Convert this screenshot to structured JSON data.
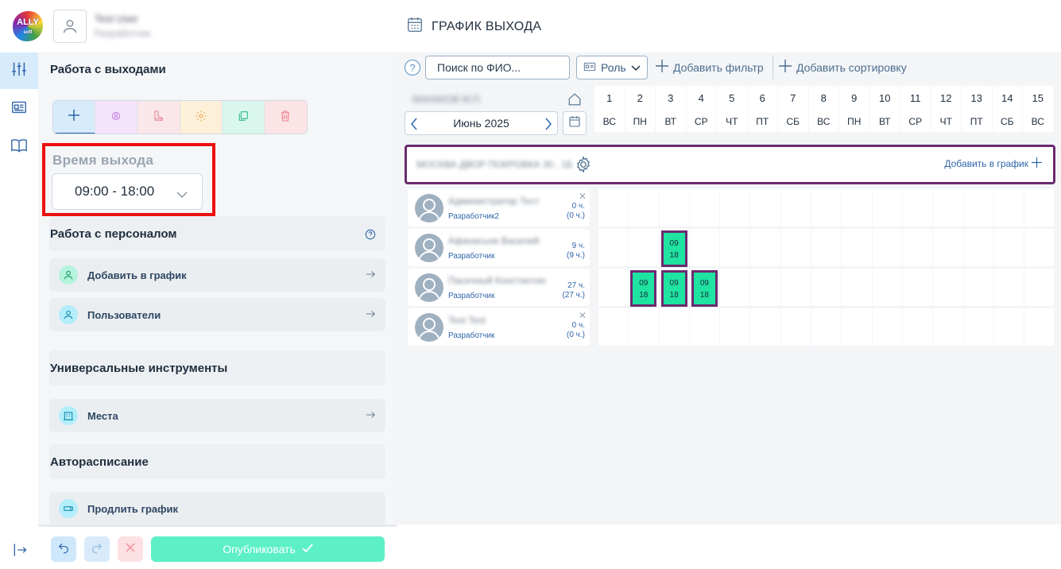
{
  "header": {
    "logo_text": "ALLY",
    "logo_sub": "soft",
    "user_name": "Test User",
    "user_role": "Разработчик",
    "title": "ГРАФИК ВЫХОДА"
  },
  "panel": {
    "work_title": "Работа с выходами",
    "time_label": "Время выхода",
    "time_value": "09:00 - 18:00",
    "personnel_title": "Работа с персоналом",
    "personnel_items": [
      "Добавить в график",
      "Пользователи"
    ],
    "universal_title": "Универсальные инструменты",
    "universal_items": [
      "Места"
    ],
    "auto_title": "Авторасписание",
    "auto_items": [
      "Продлить график"
    ]
  },
  "bottom": {
    "publish_label": "Опубликовать"
  },
  "filters": {
    "help": "?",
    "search_placeholder": "Поиск по ФИО...",
    "role_label": "Роль",
    "add_filter": "Добавить фильтр",
    "add_sort": "Добавить сортировку"
  },
  "calendar": {
    "org_name": "МАНАКОВ М.П.",
    "month": "Июнь 2025",
    "days": [
      {
        "num": "1",
        "wd": "ВС"
      },
      {
        "num": "2",
        "wd": "ПН"
      },
      {
        "num": "3",
        "wd": "ВТ"
      },
      {
        "num": "4",
        "wd": "СР"
      },
      {
        "num": "5",
        "wd": "ЧТ"
      },
      {
        "num": "6",
        "wd": "ПТ"
      },
      {
        "num": "7",
        "wd": "СБ"
      },
      {
        "num": "8",
        "wd": "ВС"
      },
      {
        "num": "9",
        "wd": "ПН"
      },
      {
        "num": "10",
        "wd": "ВТ"
      },
      {
        "num": "11",
        "wd": "СР"
      },
      {
        "num": "12",
        "wd": "ЧТ"
      },
      {
        "num": "13",
        "wd": "ПТ"
      },
      {
        "num": "14",
        "wd": "СБ"
      },
      {
        "num": "15",
        "wd": "ВС"
      }
    ]
  },
  "group": {
    "name": "МОСКВА ДВОР ПОКРОВКА 30 , 1Б",
    "add_label": "Добавить в график"
  },
  "employees": [
    {
      "name": "Администратор Тест",
      "role": "Разработчик2",
      "hours": "0 ч.",
      "hours_total": "(0 ч.)",
      "removable": true,
      "shifts": []
    },
    {
      "name": "Афанасьев Василий",
      "role": "Разработчик",
      "hours": "9 ч.",
      "hours_total": "(9 ч.)",
      "removable": false,
      "shifts": [
        3
      ]
    },
    {
      "name": "Пасечный Константин",
      "role": "Разработчик",
      "hours": "27 ч.",
      "hours_total": "(27 ч.)",
      "removable": false,
      "shifts": [
        2,
        3,
        4
      ]
    },
    {
      "name": "Test Test",
      "role": "Разработчик",
      "hours": "0 ч.",
      "hours_total": "(0 ч.)",
      "removable": true,
      "shifts": []
    }
  ],
  "shift": {
    "start": "09",
    "end": "18"
  }
}
